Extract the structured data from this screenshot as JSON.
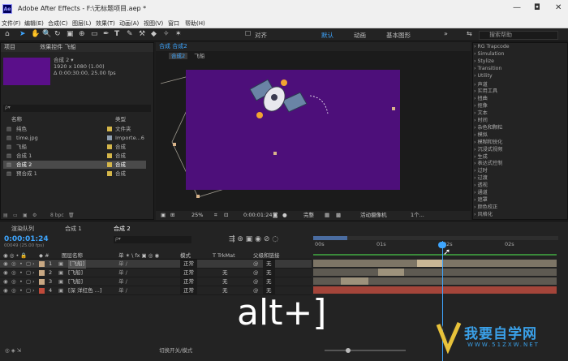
{
  "window": {
    "logo": "Ae",
    "title": "Adobe After Effects - F:\\无标题项目.aep *",
    "min": "—",
    "max": "◘",
    "close": "✕"
  },
  "menu": [
    "文件(F)",
    "编辑(E)",
    "合成(C)",
    "图层(L)",
    "效果(T)",
    "动画(A)",
    "视图(V)",
    "窗口",
    "帮助(H)"
  ],
  "toolbar": {
    "snap_label": "对齐",
    "workspaces": [
      "默认",
      "动画",
      "基本图形"
    ],
    "search_placeholder": "搜索帮助"
  },
  "project": {
    "tab_project": "项目",
    "tab_effects": "效果控件 飞船",
    "selected_name": "合成 2 ▾",
    "selected_info": [
      "1920 x 1080 (1.00)",
      "Δ 0:00:30:00, 25.00 fps"
    ],
    "col_name": "名称",
    "col_type": "类型",
    "search_placeholder": "ρ▾",
    "rows": [
      {
        "name": "纯色",
        "type": "文件夹",
        "color": "#d4b64a",
        "selected": false
      },
      {
        "name": "time.jpg",
        "type": "Importe...6",
        "color": "#8f9fb0",
        "selected": false
      },
      {
        "name": "飞船",
        "type": "合成",
        "color": "#d4b64a",
        "selected": false
      },
      {
        "name": "合成 1",
        "type": "合成",
        "color": "#d4b64a",
        "selected": false
      },
      {
        "name": "合成 2",
        "type": "合成",
        "color": "#d4b64a",
        "selected": true
      },
      {
        "name": "预合成 1",
        "type": "合成",
        "color": "#d4b64a",
        "selected": false
      }
    ],
    "bpc": "8 bpc"
  },
  "viewer": {
    "tab_label": "合成 合成2",
    "breadcrumbs": [
      "合成2",
      "飞船"
    ],
    "zoom": "25%",
    "time": "0:00:01:24",
    "quality": "完整",
    "camera": "活动摄像机",
    "views": "1个..."
  },
  "effects_panel": {
    "items": [
      "RG Trapcode",
      "Simulation",
      "Stylize",
      "Transition",
      "Utility",
      "声道",
      "实用工具",
      "扭曲",
      "抠像",
      "文本",
      "时间",
      "杂色和颗粒",
      "模拟",
      "模糊和锐化",
      "沉浸式视频",
      "生成",
      "表达式控制",
      "过时",
      "过渡",
      "透视",
      "通道",
      "遮罩",
      "颜色校正",
      "风格化"
    ]
  },
  "timeline": {
    "tabs": [
      "渲染队列",
      "合成 1",
      "合成 2"
    ],
    "timecode": "0:00:01:24",
    "timecode_sub": "00049 (25.00 fps)",
    "search_placeholder": "ρ▾",
    "col_layer": "图层名称",
    "col_mode": "模式",
    "col_trkmat": "T  TrkMat",
    "col_parent": "父级和链接",
    "ruler": [
      "00s",
      "01s",
      "02s",
      "02s"
    ],
    "layers": [
      {
        "num": "1",
        "name": "[飞船]",
        "mode": "正常",
        "trkmat": "",
        "parent": "无",
        "color": "#c8a883",
        "selected": true
      },
      {
        "num": "2",
        "name": "[飞船]",
        "mode": "正常",
        "trkmat": "无",
        "parent": "无",
        "color": "#c8a883",
        "selected": false
      },
      {
        "num": "3",
        "name": "[飞船]",
        "mode": "正常",
        "trkmat": "无",
        "parent": "无",
        "color": "#c8a883",
        "selected": false
      },
      {
        "num": "4",
        "name": "[深 洋红色 ...]",
        "mode": "正常",
        "trkmat": "无",
        "parent": "无",
        "color": "#c04a3a",
        "selected": false
      }
    ],
    "switches_label": "切换开关/模式"
  },
  "overlay": {
    "text": "alt+]"
  },
  "watermark": {
    "text": "我要自学网",
    "url": "WWW.51ZXW.NET"
  }
}
